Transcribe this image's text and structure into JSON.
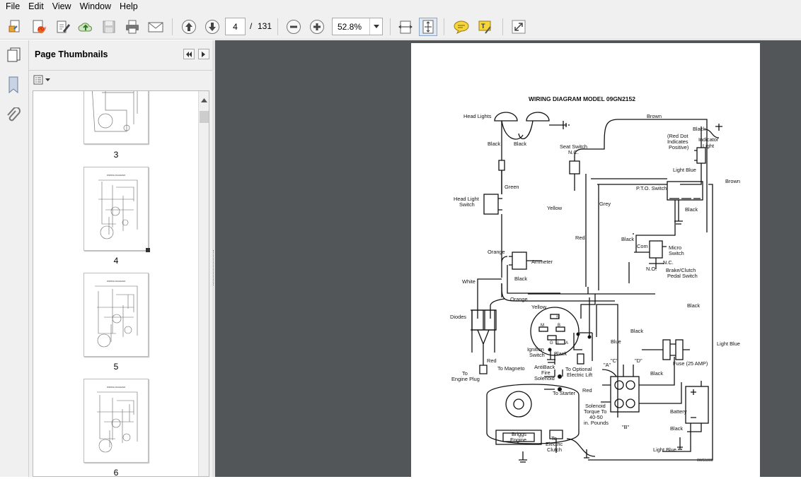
{
  "menu": {
    "file": "File",
    "edit": "Edit",
    "view": "View",
    "window": "Window",
    "help": "Help"
  },
  "toolbar": {
    "page_current": "4",
    "page_separator": "/",
    "page_total": "131",
    "zoom": "52.8%"
  },
  "panel": {
    "title": "Page Thumbnails",
    "thumbs": [
      {
        "label": "3"
      },
      {
        "label": "4"
      },
      {
        "label": "5"
      },
      {
        "label": "6"
      }
    ]
  },
  "diagram": {
    "title": "WIRING DIAGRAM MODEL 09GN2152",
    "labels": {
      "head_lights": "Head Lights",
      "black_1": "Black",
      "black_2": "Black",
      "brown_top": "Brown",
      "seat_switch": "Seat Switch",
      "nc_seat": "N.C.",
      "black_ind": "Black",
      "red_dot_1": "(Red Dot",
      "red_dot_2": "Indicates",
      "red_dot_3": "Positive)",
      "indicator_1": "Indicator",
      "indicator_2": "Light",
      "light_blue_top": "Light Blue",
      "brown_right": "Brown",
      "green": "Green",
      "head_light_sw_1": "Head Light",
      "head_light_sw_2": "Switch",
      "pto_switch": "P.T.O. Switch",
      "yellow_1": "Yellow",
      "grey": "Grey",
      "black_pto": "Black",
      "red_1": "Red",
      "black_micro": "Black",
      "com": "Com",
      "micro_1": "Micro",
      "micro_2": "Switch",
      "orange_1": "Orange",
      "ammeter": "Ammeter",
      "nc_micro": "N.C.",
      "no_micro": "N.O.",
      "brake_1": "Brake/Clutch",
      "brake_2": "Pedal Switch",
      "white": "White",
      "black_amm": "Black",
      "orange_2": "Orange",
      "yellow_2": "Yellow",
      "black_right": "Black",
      "diodes": "Diodes",
      "s": "S",
      "m": "M",
      "b": "B",
      "g": "G",
      "l": "L",
      "a": "A",
      "black_ign": "Black",
      "blue": "Blue",
      "black_mid": "Black",
      "light_blue_right": "Light Blue",
      "ignition_1": "Ignition",
      "ignition_2": "Switch",
      "c_q": "\"C\"",
      "d_q": "\"D\"",
      "a_q": "\"A\"",
      "fuse": "Fuse (25 AMP)",
      "red_diode": "Red",
      "to_magneto": "To Magneto",
      "antiback_1": "AntiBack",
      "antiback_2": "Fire",
      "antiback_3": "Solenoid",
      "to_opt_1": "To Optional",
      "to_opt_2": "Electric Lift",
      "black_sol": "Black",
      "to_plug_1": "To",
      "to_plug_2": "Engine Plug",
      "to_starter": "To Starter",
      "red_2": "Red",
      "solenoid_1": "Solenoid",
      "solenoid_2": "Torque To",
      "solenoid_3": "40-50",
      "solenoid_4": "in. Pounds",
      "b_q": "\"B\"",
      "battery": "Battery",
      "black_bat": "Black",
      "briggs_1": "Briggs",
      "briggs_2": "Engine",
      "clutch_1": "To",
      "clutch_2": "Electric",
      "clutch_3": "Clutch",
      "light_blue_bot": "Light Blue",
      "code": "0WG1000"
    }
  }
}
